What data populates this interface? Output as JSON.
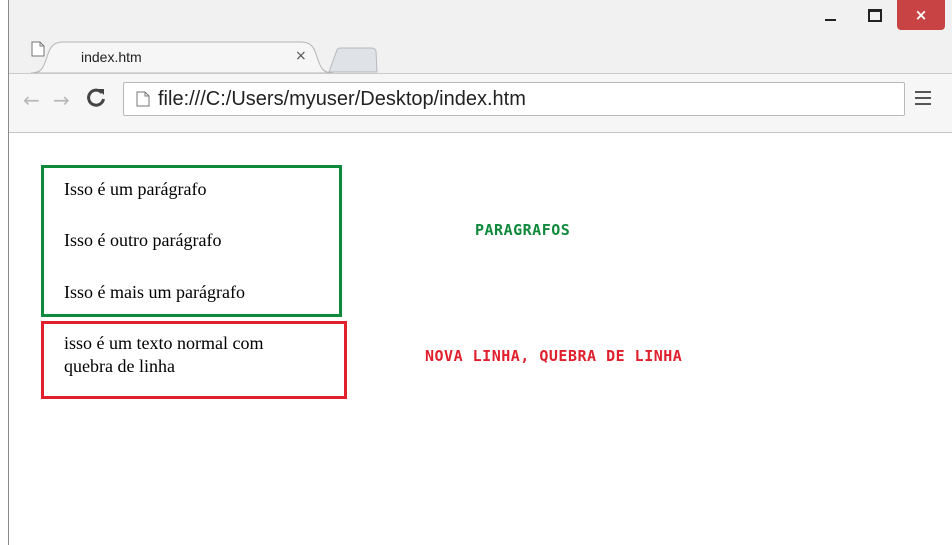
{
  "window": {
    "controls": {
      "minimize": "minimize",
      "maximize": "maximize",
      "close": "×"
    }
  },
  "tabs": [
    {
      "title": "index.htm",
      "close": "×"
    }
  ],
  "toolbar": {
    "back": "←",
    "forward": "→",
    "url": "file:///C:/Users/myuser/Desktop/index.htm"
  },
  "page": {
    "paragraphs": [
      "Isso é um parágrafo",
      "Isso é outro parágrafo",
      "Isso é mais um parágrafo"
    ],
    "plain_text_line1": "isso é um texto normal com",
    "plain_text_line2": "quebra de linha",
    "label_paragraphs": "PARAGRAFOS",
    "label_line_break": "NOVA LINHA, QUEBRA DE LINHA"
  },
  "colors": {
    "green": "#0f8a3c",
    "red": "#e0202d",
    "close_button": "#c84343"
  },
  "icons": {
    "tab": "page-icon",
    "omnibox": "page-icon",
    "reload": "reload-icon",
    "menu": "hamburger-menu-icon"
  }
}
